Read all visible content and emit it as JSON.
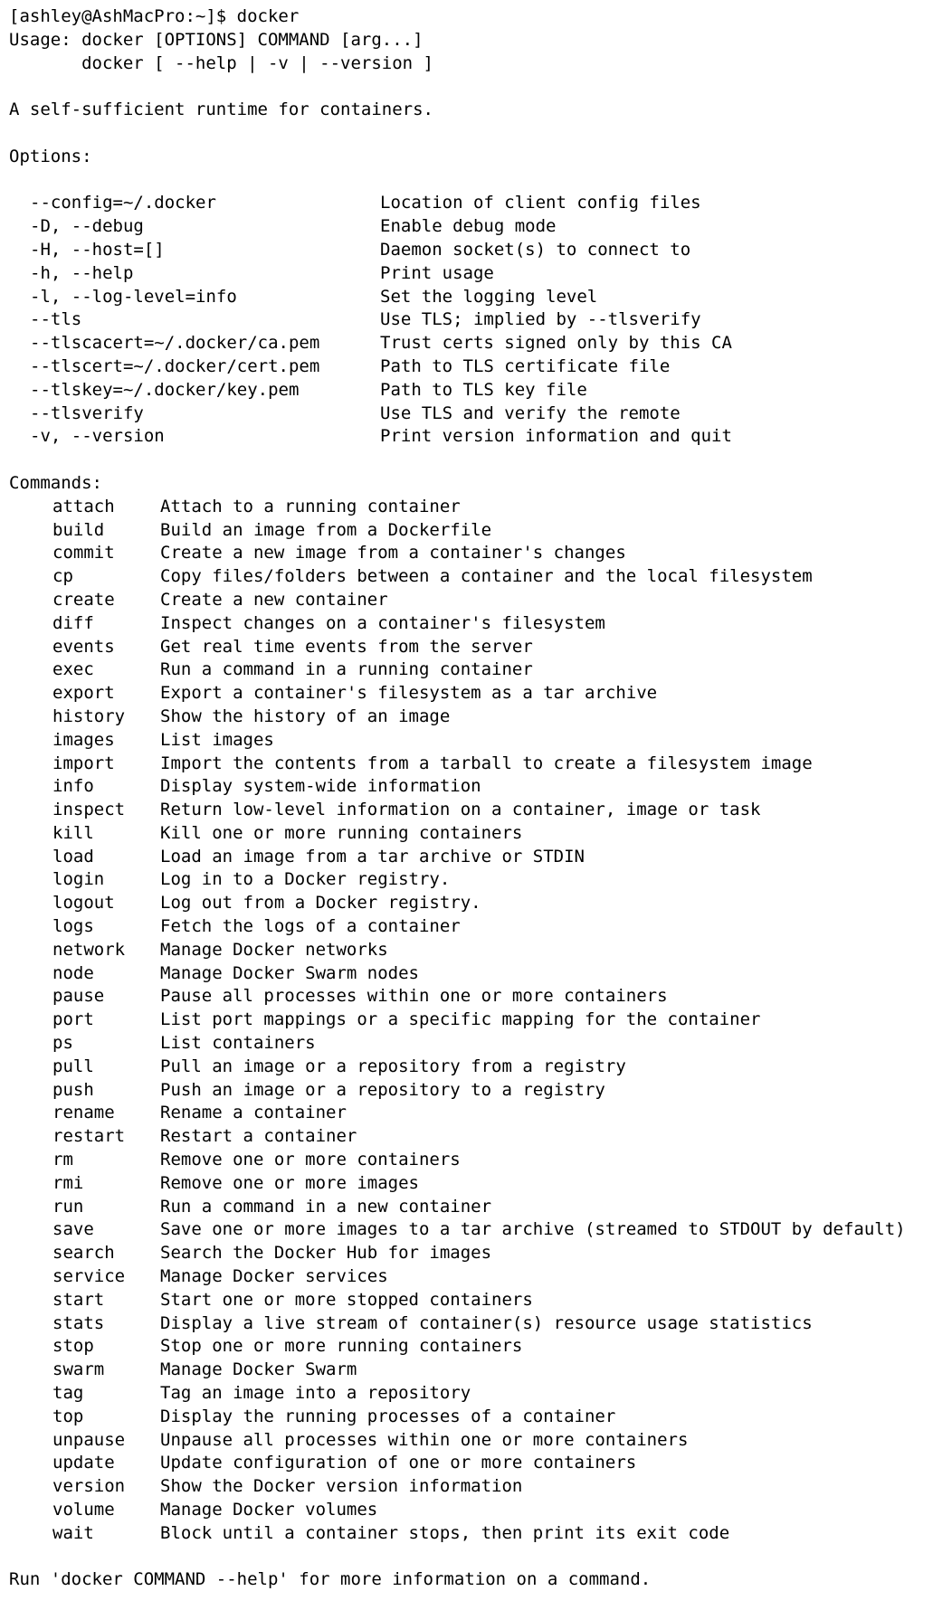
{
  "terminal": {
    "prompt": "[ashley@AshMacPro:~]$ docker",
    "usage_line1": "Usage: docker [OPTIONS] COMMAND [arg...]",
    "usage_line2": "       docker [ --help | -v | --version ]",
    "tagline": "A self-sufficient runtime for containers.",
    "options_heading": "Options:",
    "options": [
      {
        "flag": "--config=~/.docker",
        "desc": "Location of client config files"
      },
      {
        "flag": "-D, --debug",
        "desc": "Enable debug mode"
      },
      {
        "flag": "-H, --host=[]",
        "desc": "Daemon socket(s) to connect to"
      },
      {
        "flag": "-h, --help",
        "desc": "Print usage"
      },
      {
        "flag": "-l, --log-level=info",
        "desc": "Set the logging level"
      },
      {
        "flag": "--tls",
        "desc": "Use TLS; implied by --tlsverify"
      },
      {
        "flag": "--tlscacert=~/.docker/ca.pem",
        "desc": "Trust certs signed only by this CA"
      },
      {
        "flag": "--tlscert=~/.docker/cert.pem",
        "desc": "Path to TLS certificate file"
      },
      {
        "flag": "--tlskey=~/.docker/key.pem",
        "desc": "Path to TLS key file"
      },
      {
        "flag": "--tlsverify",
        "desc": "Use TLS and verify the remote"
      },
      {
        "flag": "-v, --version",
        "desc": "Print version information and quit"
      }
    ],
    "commands_heading": "Commands:",
    "commands": [
      {
        "name": "attach",
        "desc": "Attach to a running container"
      },
      {
        "name": "build",
        "desc": "Build an image from a Dockerfile"
      },
      {
        "name": "commit",
        "desc": "Create a new image from a container's changes"
      },
      {
        "name": "cp",
        "desc": "Copy files/folders between a container and the local filesystem"
      },
      {
        "name": "create",
        "desc": "Create a new container"
      },
      {
        "name": "diff",
        "desc": "Inspect changes on a container's filesystem"
      },
      {
        "name": "events",
        "desc": "Get real time events from the server"
      },
      {
        "name": "exec",
        "desc": "Run a command in a running container"
      },
      {
        "name": "export",
        "desc": "Export a container's filesystem as a tar archive"
      },
      {
        "name": "history",
        "desc": "Show the history of an image"
      },
      {
        "name": "images",
        "desc": "List images"
      },
      {
        "name": "import",
        "desc": "Import the contents from a tarball to create a filesystem image"
      },
      {
        "name": "info",
        "desc": "Display system-wide information"
      },
      {
        "name": "inspect",
        "desc": "Return low-level information on a container, image or task"
      },
      {
        "name": "kill",
        "desc": "Kill one or more running containers"
      },
      {
        "name": "load",
        "desc": "Load an image from a tar archive or STDIN"
      },
      {
        "name": "login",
        "desc": "Log in to a Docker registry."
      },
      {
        "name": "logout",
        "desc": "Log out from a Docker registry."
      },
      {
        "name": "logs",
        "desc": "Fetch the logs of a container"
      },
      {
        "name": "network",
        "desc": "Manage Docker networks"
      },
      {
        "name": "node",
        "desc": "Manage Docker Swarm nodes"
      },
      {
        "name": "pause",
        "desc": "Pause all processes within one or more containers"
      },
      {
        "name": "port",
        "desc": "List port mappings or a specific mapping for the container"
      },
      {
        "name": "ps",
        "desc": "List containers"
      },
      {
        "name": "pull",
        "desc": "Pull an image or a repository from a registry"
      },
      {
        "name": "push",
        "desc": "Push an image or a repository to a registry"
      },
      {
        "name": "rename",
        "desc": "Rename a container"
      },
      {
        "name": "restart",
        "desc": "Restart a container"
      },
      {
        "name": "rm",
        "desc": "Remove one or more containers"
      },
      {
        "name": "rmi",
        "desc": "Remove one or more images"
      },
      {
        "name": "run",
        "desc": "Run a command in a new container"
      },
      {
        "name": "save",
        "desc": "Save one or more images to a tar archive (streamed to STDOUT by default)"
      },
      {
        "name": "search",
        "desc": "Search the Docker Hub for images"
      },
      {
        "name": "service",
        "desc": "Manage Docker services"
      },
      {
        "name": "start",
        "desc": "Start one or more stopped containers"
      },
      {
        "name": "stats",
        "desc": "Display a live stream of container(s) resource usage statistics"
      },
      {
        "name": "stop",
        "desc": "Stop one or more running containers"
      },
      {
        "name": "swarm",
        "desc": "Manage Docker Swarm"
      },
      {
        "name": "tag",
        "desc": "Tag an image into a repository"
      },
      {
        "name": "top",
        "desc": "Display the running processes of a container"
      },
      {
        "name": "unpause",
        "desc": "Unpause all processes within one or more containers"
      },
      {
        "name": "update",
        "desc": "Update configuration of one or more containers"
      },
      {
        "name": "version",
        "desc": "Show the Docker version information"
      },
      {
        "name": "volume",
        "desc": "Manage Docker volumes"
      },
      {
        "name": "wait",
        "desc": "Block until a container stops, then print its exit code"
      }
    ],
    "footer": "Run 'docker COMMAND --help' for more information on a command."
  }
}
